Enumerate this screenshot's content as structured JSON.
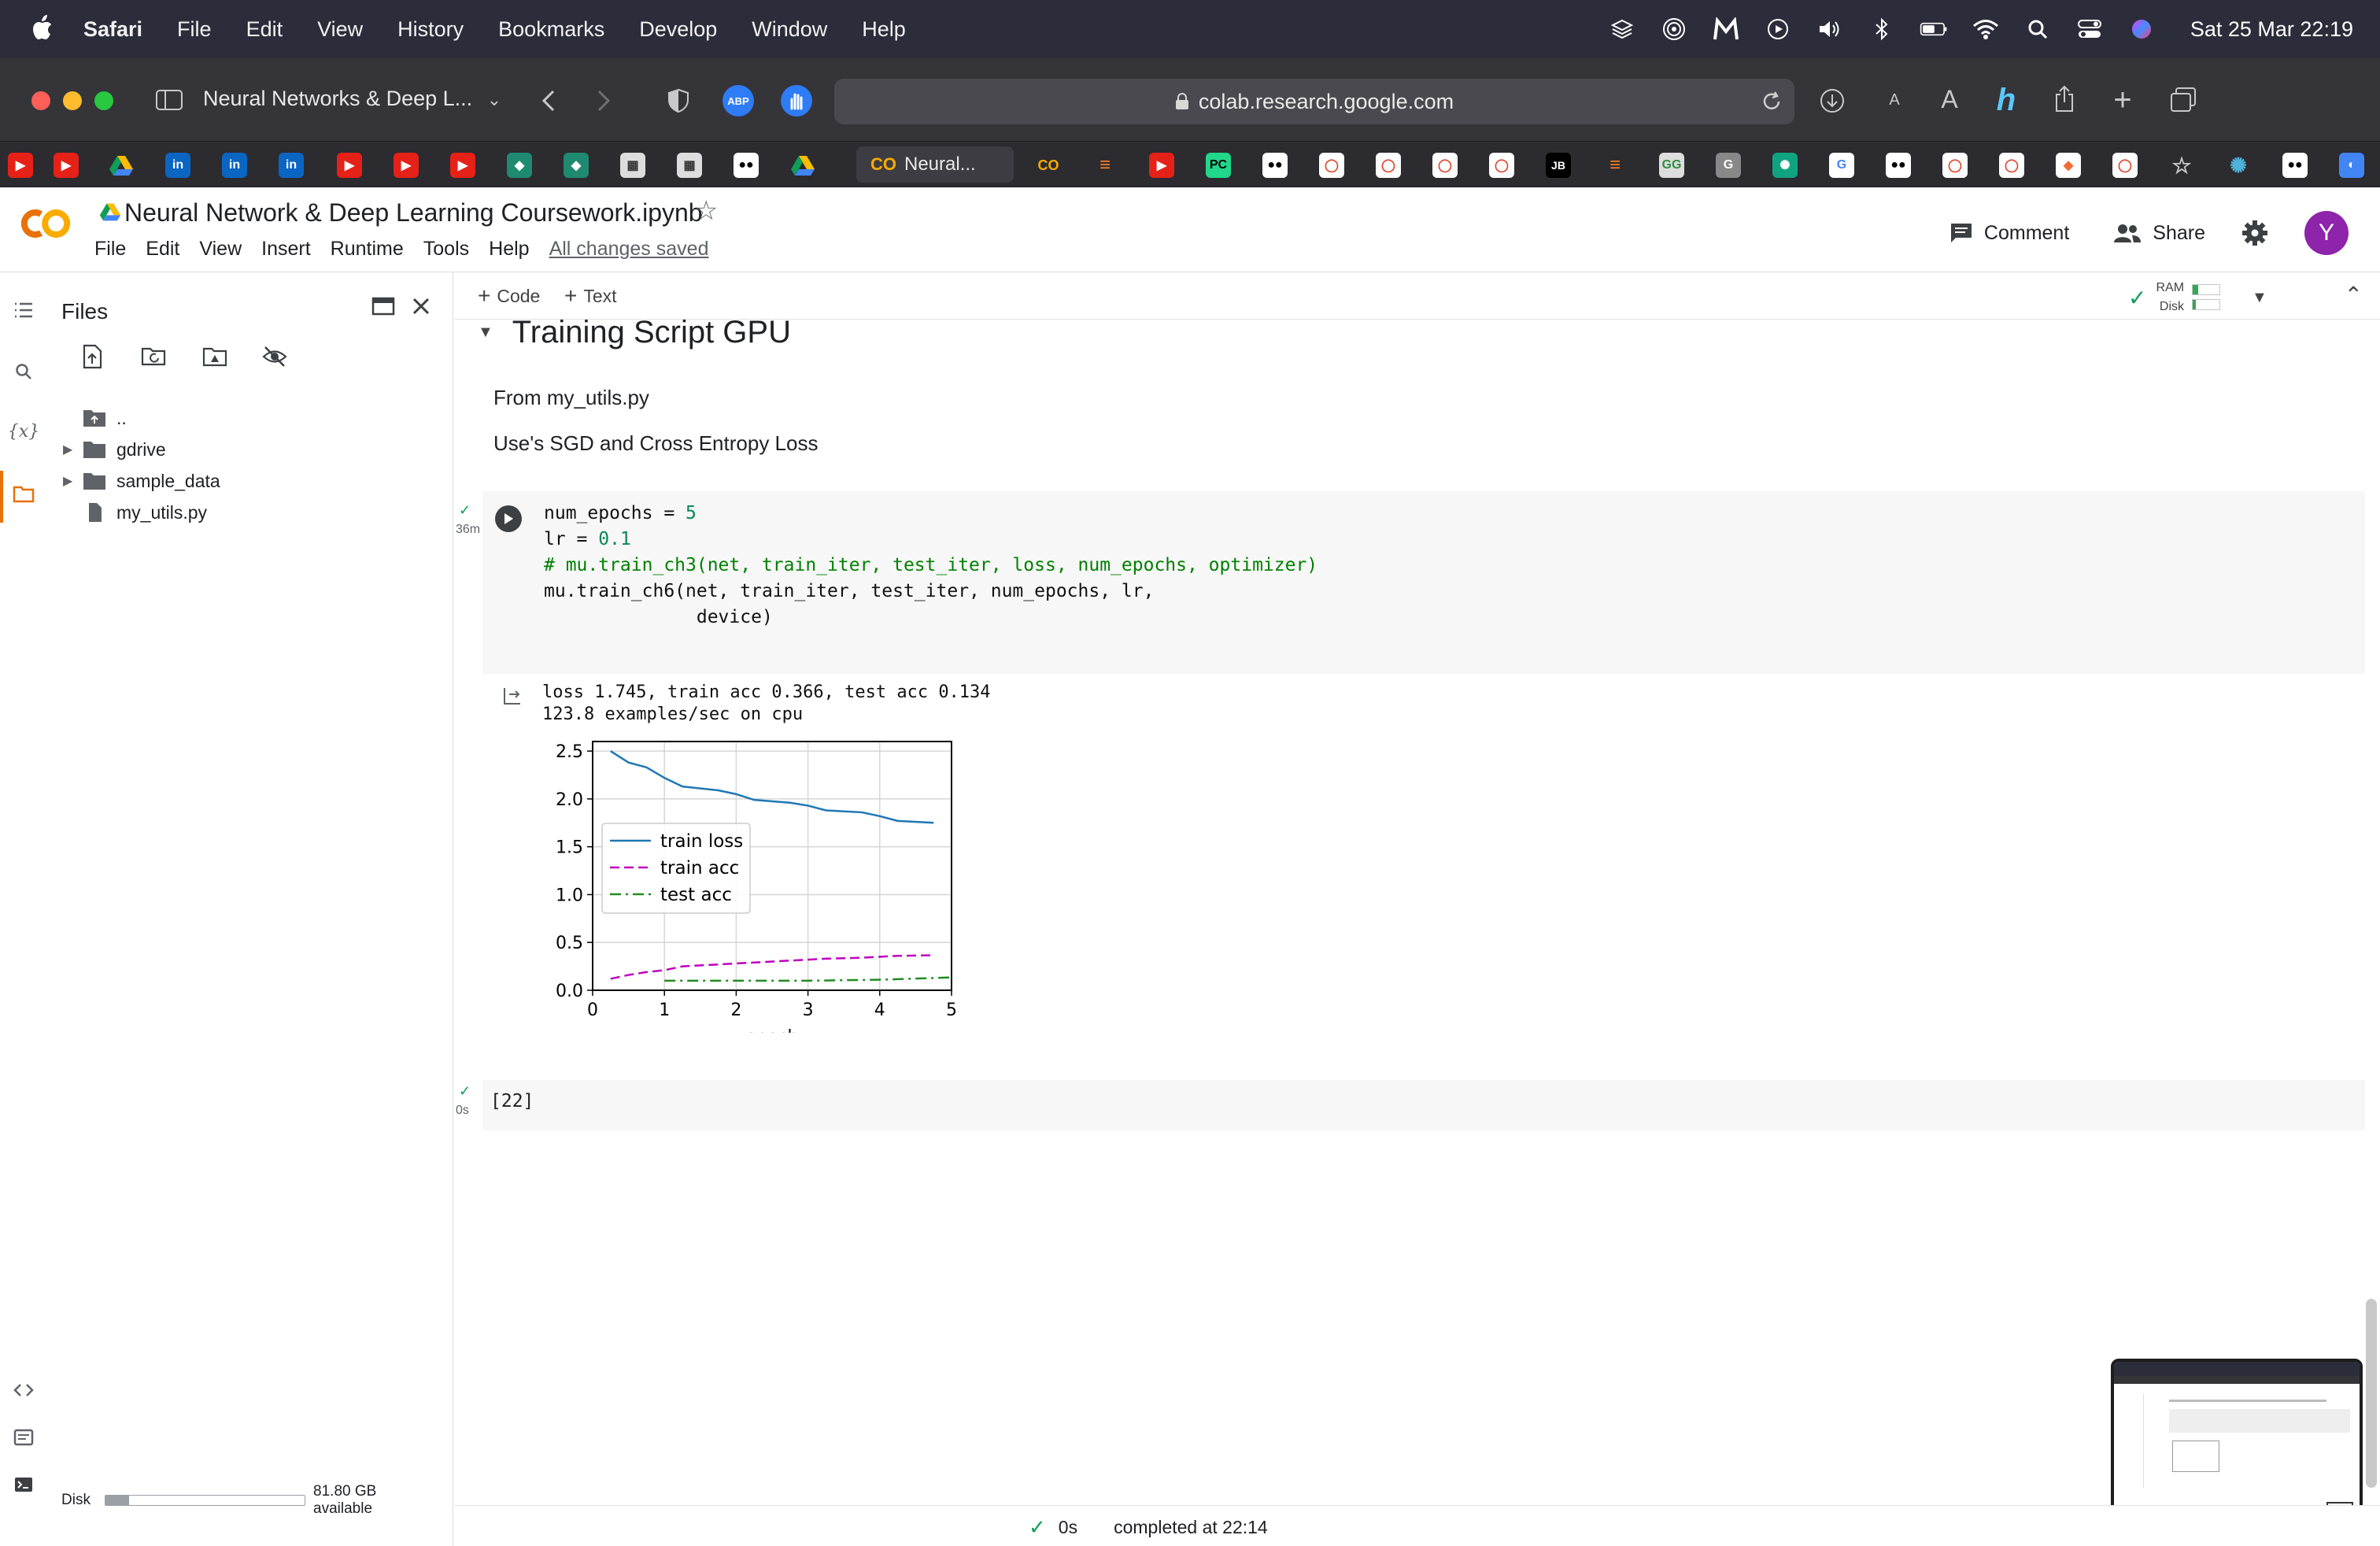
{
  "menubar": {
    "app": "Safari",
    "items": [
      "File",
      "Edit",
      "View",
      "History",
      "Bookmarks",
      "Develop",
      "Window",
      "Help"
    ],
    "clock": "Sat 25 Mar  22:19"
  },
  "safari": {
    "tab_title": "Neural Networks & Deep L...",
    "url": "colab.research.google.com",
    "active_tab": "Neural..."
  },
  "colab": {
    "notebook_title": "Neural Network & Deep Learning Coursework.ipynb",
    "menu": [
      "File",
      "Edit",
      "View",
      "Insert",
      "Runtime",
      "Tools",
      "Help"
    ],
    "saved_status": "All changes saved",
    "comment_label": "Comment",
    "share_label": "Share",
    "avatar_letter": "Y"
  },
  "files_panel": {
    "title": "Files",
    "tree": [
      {
        "name": "..",
        "type": "up"
      },
      {
        "name": "gdrive",
        "type": "folder"
      },
      {
        "name": "sample_data",
        "type": "folder"
      },
      {
        "name": "my_utils.py",
        "type": "file"
      }
    ],
    "disk_label": "Disk",
    "disk_available": "81.80 GB available",
    "disk_used_fraction": 0.12
  },
  "toolbar": {
    "add_code": "Code",
    "add_text": "Text",
    "ram_label": "RAM",
    "disk_label": "Disk"
  },
  "section": {
    "heading": "Training Script GPU",
    "lines": [
      "From my_utils.py",
      "Use's SGD and Cross Entropy Loss"
    ]
  },
  "code_cell": {
    "exec_time": "36m",
    "lines": [
      "num_epochs = 5",
      "lr = 0.1",
      "# mu.train_ch3(net, train_iter, test_iter, loss, num_epochs, optimizer)",
      "mu.train_ch6(net, train_iter, test_iter, num_epochs, lr,",
      "              device)"
    ]
  },
  "output": {
    "line1": "loss 1.745, train acc 0.366, test acc 0.134",
    "line2": "123.8 examples/sec on cpu"
  },
  "chart_data": {
    "type": "line",
    "xlabel": "epoch",
    "ylabel": "",
    "xlim": [
      0,
      5
    ],
    "ylim": [
      0,
      2.6
    ],
    "xticks": [
      0,
      1,
      2,
      3,
      4,
      5
    ],
    "yticks": [
      0.0,
      0.5,
      1.0,
      1.5,
      2.0,
      2.5
    ],
    "ytick_labels": [
      "0.0",
      "0.5",
      "1.0",
      "1.5",
      "2.0",
      "2.5"
    ],
    "grid": true,
    "legend_position": "center-left",
    "series": [
      {
        "name": "train loss",
        "color": "#1f77b4",
        "style": "solid",
        "x": [
          0.25,
          0.5,
          0.75,
          1.0,
          1.25,
          1.75,
          2.0,
          2.25,
          2.75,
          3.0,
          3.25,
          3.75,
          4.0,
          4.25,
          4.75
        ],
        "y": [
          2.5,
          2.38,
          2.33,
          2.22,
          2.13,
          2.09,
          2.05,
          1.99,
          1.96,
          1.93,
          1.88,
          1.86,
          1.82,
          1.77,
          1.75
        ]
      },
      {
        "name": "train acc",
        "color": "#bf00bf",
        "style": "dashed",
        "x": [
          0.25,
          0.5,
          0.75,
          1.0,
          1.25,
          1.75,
          2.0,
          2.25,
          2.75,
          3.0,
          3.25,
          3.75,
          4.0,
          4.25,
          4.75
        ],
        "y": [
          0.12,
          0.16,
          0.19,
          0.21,
          0.25,
          0.27,
          0.28,
          0.29,
          0.31,
          0.32,
          0.33,
          0.34,
          0.35,
          0.36,
          0.366
        ]
      },
      {
        "name": "test acc",
        "color": "#228b22",
        "style": "dashdot",
        "x": [
          1,
          2,
          3,
          4,
          5
        ],
        "y": [
          0.1,
          0.1,
          0.1,
          0.11,
          0.134
        ]
      }
    ]
  },
  "cell2": {
    "label": "[22]",
    "exec_time": "0s"
  },
  "statusbar": {
    "time": "0s",
    "text": "completed at 22:14"
  }
}
